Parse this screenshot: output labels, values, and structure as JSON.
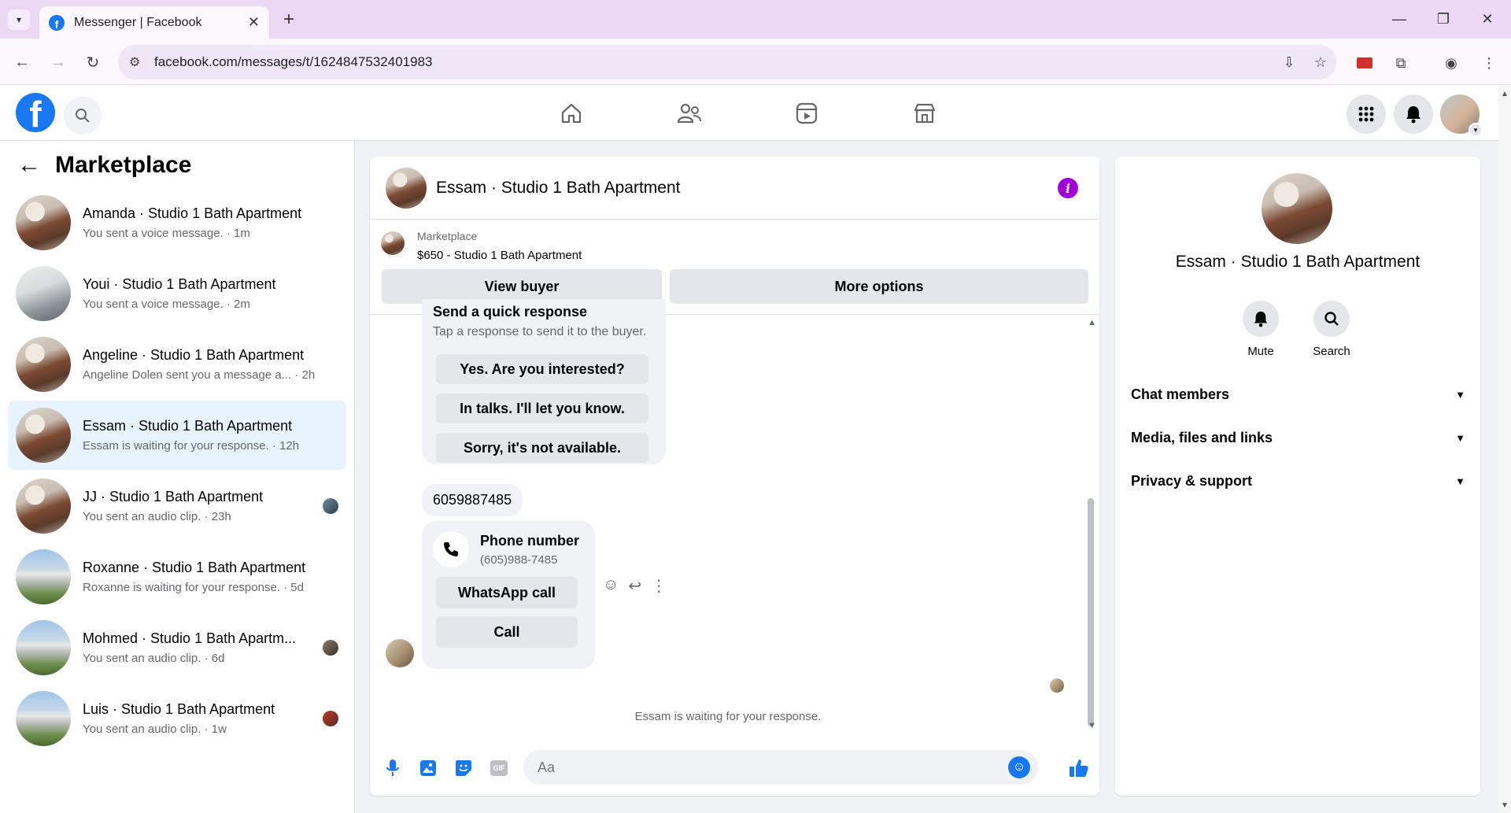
{
  "browser": {
    "tab_title": "Messenger | Facebook",
    "url": "facebook.com/messages/t/1624847532401983"
  },
  "sidebar": {
    "title": "Marketplace",
    "conversations": [
      {
        "name": "Amanda · Studio 1 Bath Apartment",
        "preview": "You sent a voice message. · 1m",
        "avatar": "kitchen"
      },
      {
        "name": "Youi · Studio 1 Bath Apartment",
        "preview": "You sent a voice message. · 2m",
        "avatar": "white"
      },
      {
        "name": "Angeline · Studio 1 Bath Apartment",
        "preview": "Angeline Dolen sent you a message a... · 2h",
        "avatar": "kitchen"
      },
      {
        "name": "Essam · Studio 1 Bath Apartment",
        "preview": "Essam is waiting for your response. · 12h",
        "avatar": "kitchen",
        "active": true
      },
      {
        "name": "JJ · Studio 1 Bath Apartment",
        "preview": "You sent an audio clip. · 23h",
        "avatar": "kitchen"
      },
      {
        "name": "Roxanne · Studio 1 Bath Apartment",
        "preview": "Roxanne is waiting for your response. · 5d",
        "avatar": "house"
      },
      {
        "name": "Mohmed · Studio 1 Bath Apartm...",
        "preview": "You sent an audio clip. · 6d",
        "avatar": "house"
      },
      {
        "name": "Luis · Studio 1 Bath Apartment",
        "preview": "You sent an audio clip. · 1w",
        "avatar": "house"
      }
    ]
  },
  "chat": {
    "title": "Essam · Studio 1 Bath Apartment",
    "marketplace_label": "Marketplace",
    "listing": "$650 - Studio 1 Bath Apartment",
    "view_buyer": "View buyer",
    "more_options": "More options",
    "quick_response_title": "Send a quick response",
    "quick_response_sub": "Tap a response to send it to the buyer.",
    "quick_responses": [
      "Yes. Are you interested?",
      "In talks. I'll let you know.",
      "Sorry, it's not available."
    ],
    "phone_message": "6059887485",
    "phone_card_title": "Phone number",
    "phone_card_number": "(605)988-7485",
    "whatsapp_call": "WhatsApp call",
    "call": "Call",
    "waiting_note": "Essam is waiting for your response.",
    "composer_placeholder": "Aa"
  },
  "info_panel": {
    "name": "Essam · Studio 1 Bath Apartment",
    "mute": "Mute",
    "search": "Search",
    "sections": [
      "Chat members",
      "Media, files and links",
      "Privacy & support"
    ]
  },
  "colors": {
    "fb_blue": "#1877f2",
    "info_purple": "#a100d8",
    "active_conv": "#e7f3ff"
  }
}
